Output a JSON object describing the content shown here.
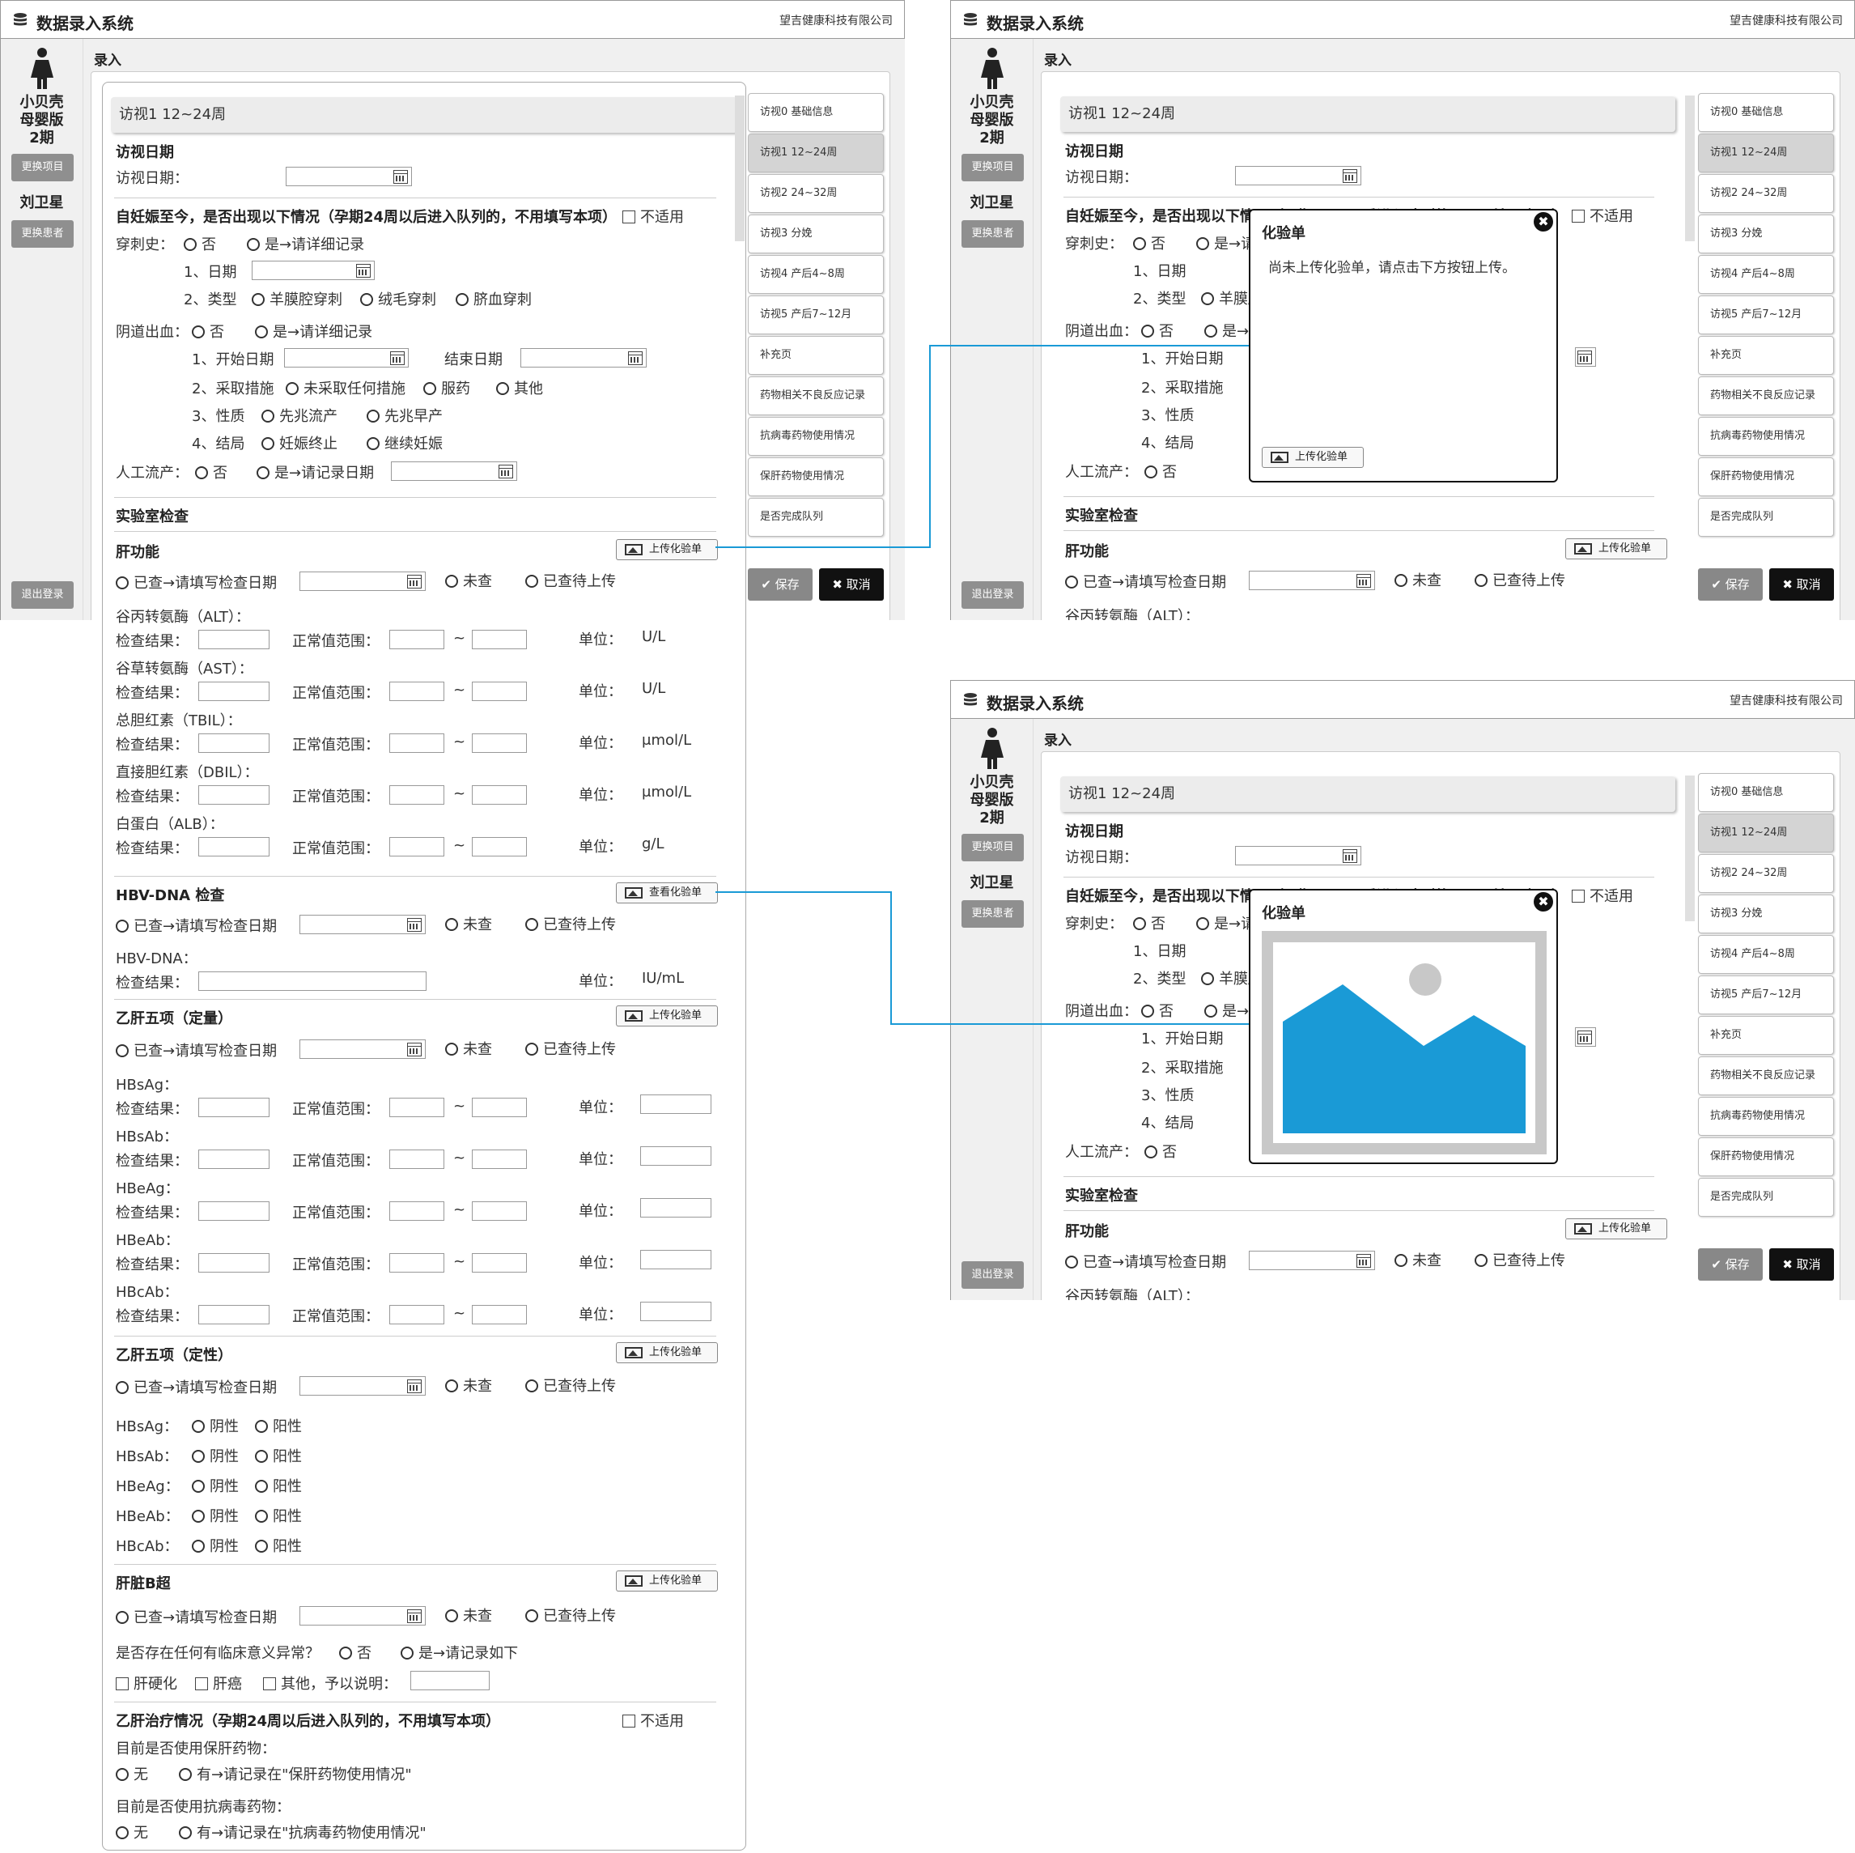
{
  "app": {
    "title": "数据录入系统",
    "company": "望吉健康科技有限公司"
  },
  "sidebar": {
    "project": "小贝壳\n母婴版\n2期",
    "change_project": "更换项目",
    "patient": "刘卫星",
    "change_patient": "更换患者",
    "logout": "退出登录"
  },
  "breadcrumb": "录入",
  "nav": [
    "访视0 基础信息",
    "访视1 12~24周",
    "访视2 24~32周",
    "访视3 分娩",
    "访视4 产后4~8周",
    "访视5 产后7~12月",
    "补充页",
    "药物相关不良反应记录",
    "抗病毒药物使用情况",
    "保肝药物使用情况",
    "是否完成队列"
  ],
  "actions": {
    "save": "保存",
    "cancel": "取消"
  },
  "form": {
    "tab": "访视1 12~24周",
    "visit_date_title": "访视日期",
    "visit_date_label": "访视日期：",
    "pregnancy_title": "自妊娠至今，是否出现以下情况（孕期24周以后进入队列的，不用填写本项）",
    "not_applicable": "不适用",
    "puncture_label": "穿刺史：",
    "no": "否",
    "yes_detail": "是→请详细记录",
    "date_1": "1、日期",
    "type_2": "2、类型",
    "amnio": "羊膜腔穿刺",
    "chorion": "绒毛穿刺",
    "cord": "脐血穿刺",
    "bleeding_label": "阴道出血：",
    "start_date": "1、开始日期",
    "end_date": "结束日期",
    "measures": "2、采取措施",
    "no_measures": "未采取任何措施",
    "medicine": "服药",
    "other": "其他",
    "nature": "3、性质",
    "threatened_abortion": "先兆流产",
    "threatened_preterm": "先兆早产",
    "outcome": "4、结局",
    "terminated": "妊娠终止",
    "continued": "继续妊娠",
    "abortion_label": "人工流产：",
    "yes_date": "是→请记录日期",
    "lab_title": "实验室检查",
    "liver_title": "肝功能",
    "upload_report": "上传化验单",
    "view_report": "查看化验单",
    "checked_date": "已查→请填写检查日期",
    "unchecked": "未查",
    "checked_pending": "已查待上传",
    "result": "检查结果：",
    "normal_range": "正常值范围：",
    "tilde": "~",
    "unit": "单位：",
    "liver_items": [
      {
        "name": "谷丙转氨酶（ALT）：",
        "unit": "U/L"
      },
      {
        "name": "谷草转氨酶（AST）：",
        "unit": "U/L"
      },
      {
        "name": "总胆红素（TBIL）：",
        "unit": "μmol/L"
      },
      {
        "name": "直接胆红素（DBIL）：",
        "unit": "μmol/L"
      },
      {
        "name": "白蛋白（ALB）：",
        "unit": "g/L"
      }
    ],
    "hbv_title": "HBV-DNA 检查",
    "hbv_item": "HBV-DNA：",
    "hbv_unit": "IU/mL",
    "hb5q_title": "乙肝五项（定量）",
    "hb5_items": [
      "HBsAg：",
      "HBsAb：",
      "HBeAg：",
      "HBeAb：",
      "HBcAb："
    ],
    "hb5l_title": "乙肝五项（定性）",
    "negative": "阴性",
    "positive": "阳性",
    "bus_title": "肝脏B超",
    "abnormal_q": "是否存在任何有临床意义异常？",
    "yes_record": "是→请记录如下",
    "cirrhosis": "肝硬化",
    "liver_cancer": "肝癌",
    "other_explain": "其他，予以说明：",
    "treat_title": "乙肝治疗情况（孕期24周以后进入队列的，不用填写本项）",
    "q_protect": "目前是否使用保肝药物：",
    "none": "无",
    "yes_protect": "有→请记录在\"保肝药物使用情况\"",
    "q_antiviral": "目前是否使用抗病毒药物：",
    "yes_antiviral": "有→请记录在\"抗病毒药物使用情况\""
  },
  "modal": {
    "title": "化验单",
    "empty_msg": "尚未上传化验单，请点击下方按钮上传。",
    "upload": "上传化验单"
  },
  "colors": {
    "connector": "#1a9ad6",
    "image_blue": "#1a9ad6"
  }
}
